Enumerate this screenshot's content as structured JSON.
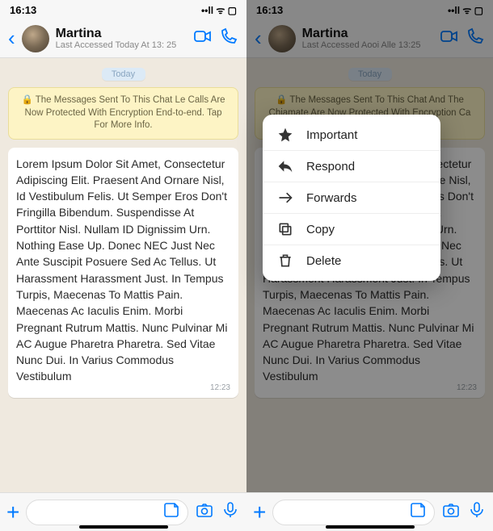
{
  "status": {
    "time": "16:13",
    "indicators": "••ll ᯤ ▢"
  },
  "header": {
    "name": "Martina",
    "last_seen_left": "Last Accessed Today At 13: 25",
    "last_seen_right": "Last Accessed Aooi Alle 13:25"
  },
  "day_pill": "Today",
  "notice_left": "🔒 The Messages Sent To This Chat Le Calls Are Now Protected With Encryption End-to-end. Tap For More Info.",
  "notice_right": "🔒 The Messages Sent To This Chat And The Chiamate Are Now Protected With Encryption Ca For Maooion Info.",
  "message": {
    "body": "Lorem Ipsum Dolor Sit Amet, Consectetur Adipiscing Elit. Praesent And Ornare Nisl, Id Vestibulum Felis. Ut Semper Eros Don't Fringilla Bibendum. Suspendisse At Porttitor Nisl. Nullam ID Dignissim Urn. Nothing Ease Up. Donec NEC Just Nec Ante Suscipit Posuere Sed Ac Tellus. Ut Harassment Harassment Just. In Tempus Turpis, Maecenas To Mattis Pain. Maecenas Ac Iaculis Enim. Morbi Pregnant Rutrum Mattis. Nunc Pulvinar Mi AC Augue Pharetra Pharetra. Sed Vitae Nunc Dui. In Varius Commodus Vestibulum",
    "time": "12:23"
  },
  "menu": {
    "important": "Important",
    "respond": "Respond",
    "forwards": "Forwards",
    "copy": "Copy",
    "delete": "Delete"
  }
}
